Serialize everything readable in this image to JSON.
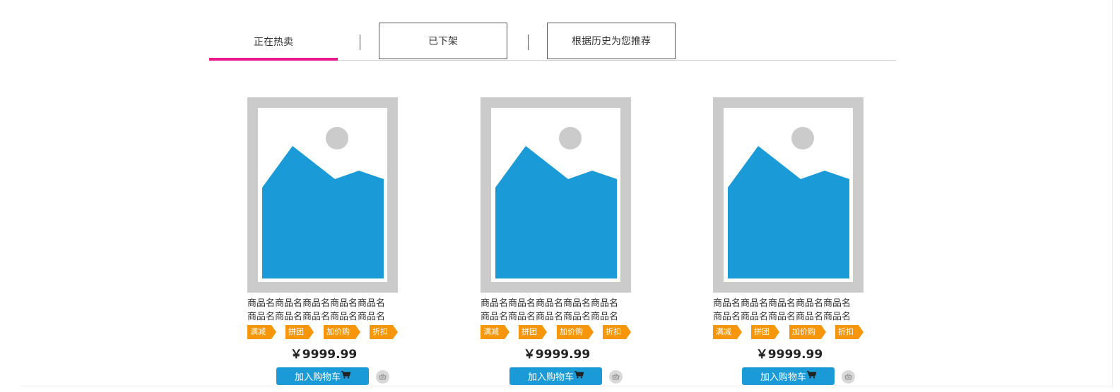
{
  "tabs": [
    {
      "label": "正在热卖",
      "active": true
    },
    {
      "label": "已下架",
      "active": false
    },
    {
      "label": "根据历史为您推荐",
      "active": false
    }
  ],
  "colors": {
    "accent_underline": "#e8188b",
    "tag_bg": "#f7960b",
    "cart_button": "#1a9bd7",
    "image_placeholder": "#1a9bd7"
  },
  "products": [
    {
      "image_icon": "image-placeholder-icon",
      "name_line1": "商品名商品名商品名商品名商品名",
      "name_line2": "商品名商品名商品名商品名商品名",
      "tags": [
        "满减",
        "拼团",
        "加价购",
        "折扣"
      ],
      "price": "￥9999.99",
      "cart_label": "加入购物车",
      "cart_icon": "shopping-cart-icon",
      "fav_icon": "basket-icon"
    },
    {
      "image_icon": "image-placeholder-icon",
      "name_line1": "商品名商品名商品名商品名商品名",
      "name_line2": "商品名商品名商品名商品名商品名",
      "tags": [
        "满减",
        "拼团",
        "加价购",
        "折扣"
      ],
      "price": "￥9999.99",
      "cart_label": "加入购物车",
      "cart_icon": "shopping-cart-icon",
      "fav_icon": "basket-icon"
    },
    {
      "image_icon": "image-placeholder-icon",
      "name_line1": "商品名商品名商品名商品名商品名",
      "name_line2": "商品名商品名商品名商品名商品名",
      "tags": [
        "满减",
        "拼团",
        "加价购",
        "折扣"
      ],
      "price": "￥9999.99",
      "cart_label": "加入购物车",
      "cart_icon": "shopping-cart-icon",
      "fav_icon": "basket-icon"
    }
  ]
}
